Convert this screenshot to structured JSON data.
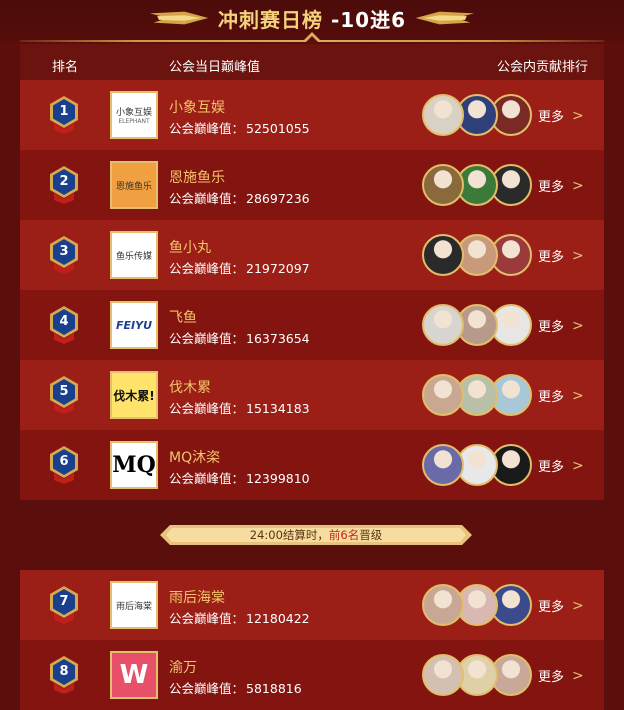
{
  "title": {
    "main": "冲刺赛日榜",
    "sub": "-10进6"
  },
  "headers": {
    "rank": "排名",
    "peak": "公会当日巅峰值",
    "contrib": "公会内贡献排行"
  },
  "peak_label": "公会巅峰值：",
  "more_label": "更多",
  "notice": {
    "pre": "24:00结算时，",
    "highlight": "前6名",
    "post": "晋级"
  },
  "rows": [
    {
      "rank": "1",
      "name": "小象互娱",
      "peak": "52501055",
      "logo_text": "小象互娱",
      "logo_sub": "ELEPHANT",
      "avatars": [
        {
          "color": "#d9d2c4"
        },
        {
          "color": "#2f3f7a"
        },
        {
          "color": "#7a2a24"
        }
      ]
    },
    {
      "rank": "2",
      "name": "恩施鱼乐",
      "peak": "28697236",
      "logo_text": "恩施鱼乐",
      "logo_sub": "",
      "avatars": [
        {
          "color": "#8a6a3a"
        },
        {
          "color": "#3c7a3a"
        },
        {
          "color": "#2a2a2a"
        }
      ]
    },
    {
      "rank": "3",
      "name": "鱼小丸",
      "peak": "21972097",
      "logo_text": "鱼乐传媒",
      "logo_sub": "",
      "avatars": [
        {
          "color": "#2a2a2a"
        },
        {
          "color": "#c89a7a"
        },
        {
          "color": "#9a3a3a"
        }
      ]
    },
    {
      "rank": "4",
      "name": "飞鱼",
      "peak": "16373654",
      "logo_text": "FEIYU",
      "logo_sub": "",
      "avatars": [
        {
          "color": "#d8d4d0"
        },
        {
          "color": "#b89a8a"
        },
        {
          "color": "#e8e6e4"
        }
      ]
    },
    {
      "rank": "5",
      "name": "伐木累",
      "peak": "15134183",
      "logo_text": "伐木累!",
      "logo_sub": "",
      "avatars": [
        {
          "color": "#c8a890"
        },
        {
          "color": "#b8c0a8"
        },
        {
          "color": "#a8c8d8"
        }
      ]
    },
    {
      "rank": "6",
      "name": "MQ沐栥",
      "peak": "12399810",
      "logo_text": "MQ",
      "logo_sub": "",
      "avatars": [
        {
          "color": "#6a6aa8"
        },
        {
          "color": "#e8e8ea"
        },
        {
          "color": "#1a1a1a"
        }
      ]
    },
    {
      "rank": "7",
      "name": "雨后海棠",
      "peak": "12180422",
      "logo_text": "雨后海棠",
      "logo_sub": "",
      "avatars": [
        {
          "color": "#c8a894"
        },
        {
          "color": "#d8b8b0"
        },
        {
          "color": "#3a4a8a"
        }
      ]
    },
    {
      "rank": "8",
      "name": "渝万",
      "peak": "5818816",
      "logo_text": "W",
      "logo_sub": "",
      "avatars": [
        {
          "color": "#d4c0b0"
        },
        {
          "color": "#e0d0a8"
        },
        {
          "color": "#c8a898"
        }
      ]
    }
  ],
  "colors": {
    "gold": "#f3c56b",
    "row_a": "#9b1f17",
    "row_b": "#84140f",
    "bg": "#5a0f0c"
  }
}
